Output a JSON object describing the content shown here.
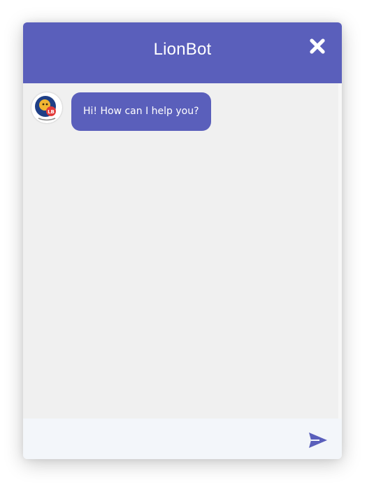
{
  "header": {
    "title": "LionBot",
    "close_icon": "close-icon",
    "background": "#5a5fbb"
  },
  "messages": [
    {
      "sender": "bot",
      "avatar_icon": "lionbot-avatar-icon",
      "avatar_badge": "LB",
      "text": "Hi! How can I help you?"
    }
  ],
  "composer": {
    "input_value": "",
    "input_placeholder": "",
    "send_icon": "send-icon"
  },
  "colors": {
    "accent": "#5a5fbb",
    "body_background": "#f0f0f0",
    "footer_background": "#f3f6fa"
  }
}
